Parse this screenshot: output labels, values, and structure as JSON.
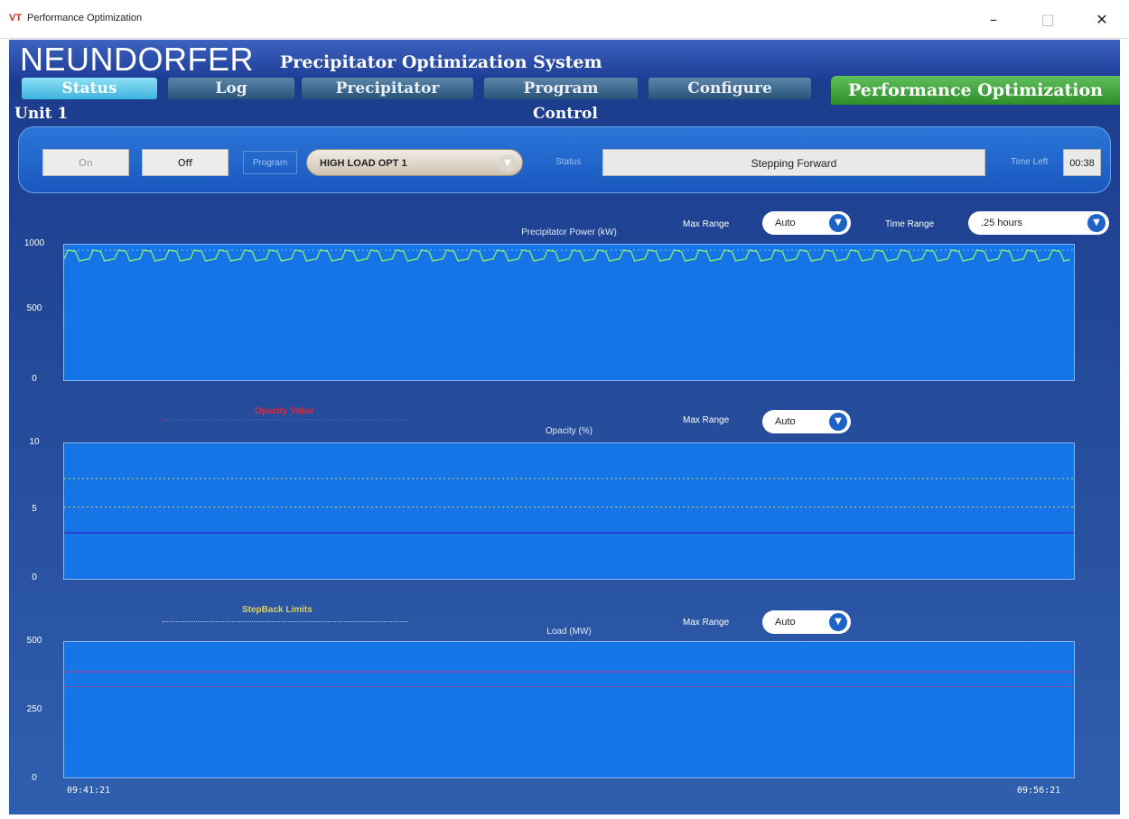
{
  "window": {
    "icon_text": "VT",
    "title": "Performance Optimization"
  },
  "colors": {
    "plot_bg": "#1675e6",
    "power_line": "#7ee07a",
    "opacity_blue": "#2a3fd8",
    "limit_yellow": "#d8d05a",
    "alarm_red": "#e0283a",
    "load_red": "#c83a8a"
  },
  "header": {
    "brand": "NEUNDORFER",
    "subtitle": "Precipitator Optimization System"
  },
  "tabs": [
    {
      "label": "Status",
      "active": true
    },
    {
      "label": "Log",
      "active": false
    },
    {
      "label": "Precipitator",
      "active": false
    },
    {
      "label": "Program",
      "active": false
    },
    {
      "label": "Configure",
      "active": false
    },
    {
      "label": "Performance Optimization",
      "active": false
    }
  ],
  "unit_title": "Unit 1",
  "control_title": "Control",
  "control": {
    "on_label": "On",
    "off_label": "Off",
    "program_label": "Program",
    "program_value": "HIGH LOAD OPT 1",
    "status_label": "Status",
    "status_value": "Stepping Forward",
    "time_left_label": "Time Left",
    "time_left_value": "00:38"
  },
  "chart_data": [
    {
      "type": "line",
      "title": "Precipitator Power (kW)",
      "max_range_label": "Max Range",
      "max_range_value": "Auto",
      "time_range_label": "Time Range",
      "time_range_value": ".25 hours",
      "y_ticks": [
        "1000",
        "500",
        "0"
      ],
      "ylim": [
        0,
        1000
      ],
      "series": [
        {
          "pattern": "sawtooth",
          "min": 880,
          "max": 960,
          "cycles": 40,
          "color": "#7ee07a"
        }
      ],
      "grid": false
    },
    {
      "type": "line",
      "title": "Opacity (%)",
      "max_range_label": "Max Range",
      "max_range_value": "Auto",
      "legend_label": "Opacity Value",
      "y_ticks": [
        "10",
        "5",
        "0"
      ],
      "ylim": [
        0,
        10
      ],
      "limits": [
        7.4,
        5.3
      ],
      "series": [
        {
          "value": 3.4,
          "color": "#2a3fd8"
        }
      ],
      "grid": false
    },
    {
      "type": "line",
      "title": "Load (MW)",
      "max_range_label": "Max Range",
      "max_range_value": "Auto",
      "legend_label": "StepBack Limits",
      "y_ticks": [
        "500",
        "250",
        "0"
      ],
      "ylim": [
        0,
        500
      ],
      "series": [
        {
          "value": 390,
          "color": "#c83a8a"
        },
        {
          "value": 335,
          "color": "#c83a8a"
        }
      ],
      "grid": false
    }
  ],
  "time_axis": {
    "start": "09:41:21",
    "end": "09:56:21"
  }
}
